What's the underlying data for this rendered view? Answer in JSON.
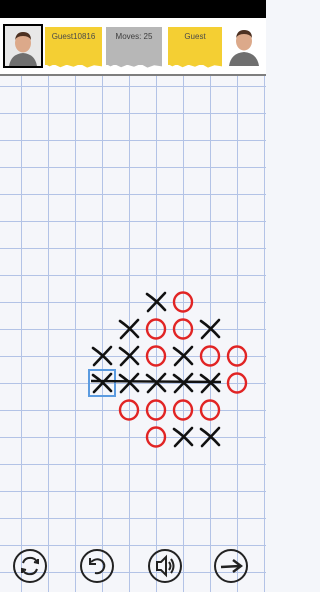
{
  "players": {
    "left": {
      "name": "Guest10816",
      "avatar": "male-avatar-icon"
    },
    "moves_label": "Moves: 25",
    "right": {
      "name": "Guest",
      "avatar": "male-avatar-icon"
    }
  },
  "board": {
    "marks": [
      {
        "col": 4,
        "row": 8,
        "symbol": "X"
      },
      {
        "col": 5,
        "row": 8,
        "symbol": "O"
      },
      {
        "col": 3,
        "row": 9,
        "symbol": "X"
      },
      {
        "col": 4,
        "row": 9,
        "symbol": "O"
      },
      {
        "col": 5,
        "row": 9,
        "symbol": "O"
      },
      {
        "col": 6,
        "row": 9,
        "symbol": "X"
      },
      {
        "col": 2,
        "row": 10,
        "symbol": "X"
      },
      {
        "col": 3,
        "row": 10,
        "symbol": "X"
      },
      {
        "col": 4,
        "row": 10,
        "symbol": "O"
      },
      {
        "col": 5,
        "row": 10,
        "symbol": "X"
      },
      {
        "col": 6,
        "row": 10,
        "symbol": "O"
      },
      {
        "col": 7,
        "row": 10,
        "symbol": "O"
      },
      {
        "col": 2,
        "row": 11,
        "symbol": "X"
      },
      {
        "col": 3,
        "row": 11,
        "symbol": "X"
      },
      {
        "col": 4,
        "row": 11,
        "symbol": "X"
      },
      {
        "col": 5,
        "row": 11,
        "symbol": "X"
      },
      {
        "col": 6,
        "row": 11,
        "symbol": "X"
      },
      {
        "col": 7,
        "row": 11,
        "symbol": "O"
      },
      {
        "col": 3,
        "row": 12,
        "symbol": "O"
      },
      {
        "col": 4,
        "row": 12,
        "symbol": "O"
      },
      {
        "col": 5,
        "row": 12,
        "symbol": "O"
      },
      {
        "col": 6,
        "row": 12,
        "symbol": "O"
      },
      {
        "col": 4,
        "row": 13,
        "symbol": "O"
      },
      {
        "col": 5,
        "row": 13,
        "symbol": "X"
      },
      {
        "col": 6,
        "row": 13,
        "symbol": "X"
      }
    ],
    "last_move": {
      "col": 2,
      "row": 11
    },
    "win_line": {
      "from": {
        "col": 2,
        "row": 11
      },
      "to": {
        "col": 6,
        "row": 11
      }
    },
    "colors": {
      "x": "#111111",
      "o": "#e12424",
      "grid": "#b3c3e6",
      "highlight": "#5b9be0"
    }
  },
  "controls": [
    {
      "id": "restart",
      "icon": "restart-icon"
    },
    {
      "id": "undo",
      "icon": "undo-icon"
    },
    {
      "id": "sound",
      "icon": "sound-icon"
    },
    {
      "id": "next",
      "icon": "arrow-right-icon"
    }
  ]
}
